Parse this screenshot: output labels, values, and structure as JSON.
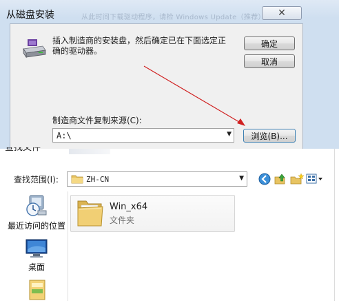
{
  "install_dialog": {
    "title": "从磁盘安装",
    "ghost_text": "从此时间下载驱动程序，请检  Windows Update（推荐）",
    "close_glyph": "✕",
    "message": "插入制造商的安装盘，然后确定已在下面选定正确的驱动器。",
    "ok_label": "确定",
    "cancel_label": "取消",
    "source_label": "制造商文件复制来源(C):",
    "source_value": "A:\\",
    "browse_label": "浏览(B)...",
    "icons": [
      "disk-drive-icon"
    ],
    "annotation_color": "#d02020"
  },
  "find_file_dialog": {
    "title": "查找文件",
    "look_in_label": "查找范围(I):",
    "look_in_value": "ZH-CN",
    "toolbar_icons": [
      "back-icon",
      "up-folder-icon",
      "new-folder-icon",
      "view-menu-icon"
    ],
    "places": [
      {
        "label": "最近访问的位置",
        "icon": "recent-places-icon"
      },
      {
        "label": "桌面",
        "icon": "desktop-icon"
      },
      {
        "label": "",
        "icon": "libraries-icon"
      }
    ],
    "files": [
      {
        "name": "Win_x64",
        "type": "文件夹",
        "icon": "folder-icon"
      }
    ]
  }
}
